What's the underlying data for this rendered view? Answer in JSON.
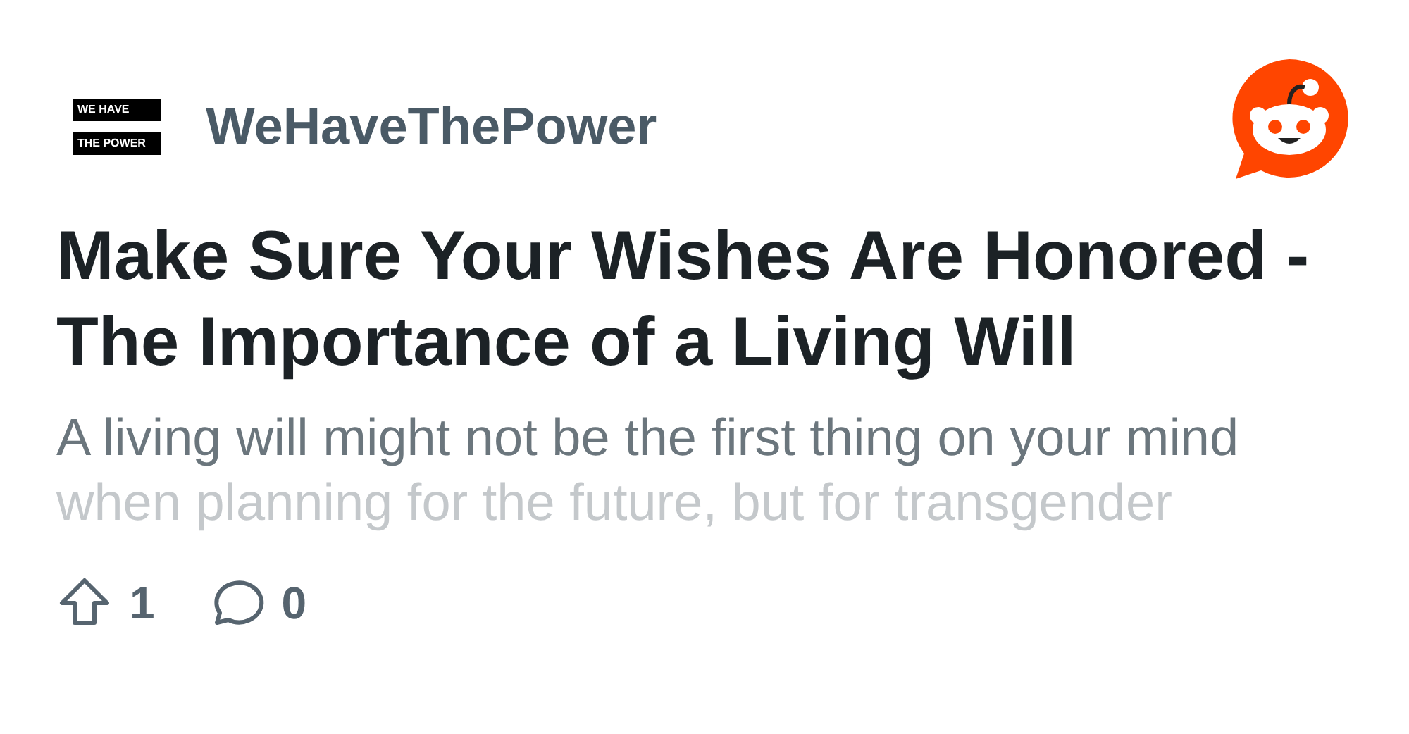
{
  "community": {
    "logo_lines": [
      "WE HAVE",
      "THE POWER"
    ],
    "name": "WeHaveThePower"
  },
  "post": {
    "title": "Make Sure Your Wishes Are Honored - The Importance of a Living Will",
    "body_lines": [
      {
        "text": "A living will might not be the first thing on your mind",
        "faded": false
      },
      {
        "text": "when planning for the future, but for transgender",
        "faded": true
      }
    ]
  },
  "stats": {
    "upvotes": "1",
    "comments": "0"
  }
}
